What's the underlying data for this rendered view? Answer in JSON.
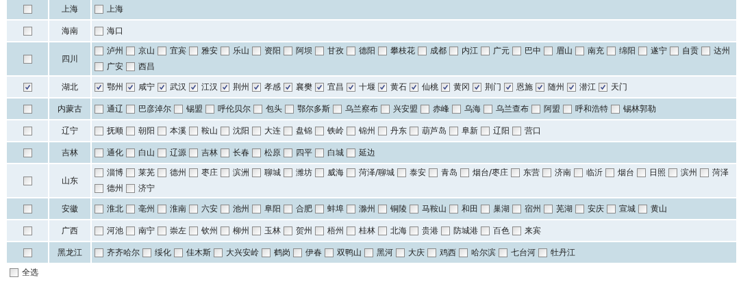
{
  "provinces": [
    {
      "name": "上海",
      "checked": false,
      "cities": [
        {
          "name": "上海",
          "checked": false
        }
      ]
    },
    {
      "name": "海南",
      "checked": false,
      "cities": [
        {
          "name": "海口",
          "checked": false
        }
      ]
    },
    {
      "name": "四川",
      "checked": false,
      "cities": [
        {
          "name": "泸州",
          "checked": false
        },
        {
          "name": "京山",
          "checked": false
        },
        {
          "name": "宜宾",
          "checked": false
        },
        {
          "name": "雅安",
          "checked": false
        },
        {
          "name": "乐山",
          "checked": false
        },
        {
          "name": "资阳",
          "checked": false
        },
        {
          "name": "阿坝",
          "checked": false
        },
        {
          "name": "甘孜",
          "checked": false
        },
        {
          "name": "德阳",
          "checked": false
        },
        {
          "name": "攀枝花",
          "checked": false
        },
        {
          "name": "成都",
          "checked": false
        },
        {
          "name": "内江",
          "checked": false
        },
        {
          "name": "广元",
          "checked": false
        },
        {
          "name": "巴中",
          "checked": false
        },
        {
          "name": "眉山",
          "checked": false
        },
        {
          "name": "南充",
          "checked": false
        },
        {
          "name": "绵阳",
          "checked": false
        },
        {
          "name": "遂宁",
          "checked": false
        },
        {
          "name": "自贡",
          "checked": false
        },
        {
          "name": "达州",
          "checked": false
        },
        {
          "name": "广安",
          "checked": false
        },
        {
          "name": "西昌",
          "checked": false
        }
      ]
    },
    {
      "name": "湖北",
      "checked": true,
      "cities": [
        {
          "name": "鄂州",
          "checked": true
        },
        {
          "name": "咸宁",
          "checked": true
        },
        {
          "name": "武汉",
          "checked": true
        },
        {
          "name": "江汉",
          "checked": true
        },
        {
          "name": "荆州",
          "checked": true
        },
        {
          "name": "孝感",
          "checked": true
        },
        {
          "name": "襄樊",
          "checked": true
        },
        {
          "name": "宜昌",
          "checked": true
        },
        {
          "name": "十堰",
          "checked": true
        },
        {
          "name": "黄石",
          "checked": true
        },
        {
          "name": "仙桃",
          "checked": true
        },
        {
          "name": "黄冈",
          "checked": true
        },
        {
          "name": "荆门",
          "checked": true
        },
        {
          "name": "恩施",
          "checked": true
        },
        {
          "name": "随州",
          "checked": true
        },
        {
          "name": "潜江",
          "checked": true
        },
        {
          "name": "天门",
          "checked": true
        }
      ]
    },
    {
      "name": "内蒙古",
      "checked": false,
      "cities": [
        {
          "name": "通辽",
          "checked": false
        },
        {
          "name": "巴彦淖尔",
          "checked": false
        },
        {
          "name": "锡盟",
          "checked": false
        },
        {
          "name": "呼伦贝尔",
          "checked": false
        },
        {
          "name": "包头",
          "checked": false
        },
        {
          "name": "鄂尔多斯",
          "checked": false
        },
        {
          "name": "乌兰察布",
          "checked": false
        },
        {
          "name": "兴安盟",
          "checked": false
        },
        {
          "name": "赤峰",
          "checked": false
        },
        {
          "name": "乌海",
          "checked": false
        },
        {
          "name": "乌兰查布",
          "checked": false
        },
        {
          "name": "阿盟",
          "checked": false
        },
        {
          "name": "呼和浩特",
          "checked": false
        },
        {
          "name": "锡林郭勒",
          "checked": false
        }
      ]
    },
    {
      "name": "辽宁",
      "checked": false,
      "cities": [
        {
          "name": "抚顺",
          "checked": false
        },
        {
          "name": "朝阳",
          "checked": false
        },
        {
          "name": "本溪",
          "checked": false
        },
        {
          "name": "鞍山",
          "checked": false
        },
        {
          "name": "沈阳",
          "checked": false
        },
        {
          "name": "大连",
          "checked": false
        },
        {
          "name": "盘锦",
          "checked": false
        },
        {
          "name": "铁岭",
          "checked": false
        },
        {
          "name": "锦州",
          "checked": false
        },
        {
          "name": "丹东",
          "checked": false
        },
        {
          "name": "葫芦岛",
          "checked": false
        },
        {
          "name": "阜新",
          "checked": false
        },
        {
          "name": "辽阳",
          "checked": false
        },
        {
          "name": "营口",
          "checked": false
        }
      ]
    },
    {
      "name": "吉林",
      "checked": false,
      "cities": [
        {
          "name": "通化",
          "checked": false
        },
        {
          "name": "白山",
          "checked": false
        },
        {
          "name": "辽源",
          "checked": false
        },
        {
          "name": "吉林",
          "checked": false
        },
        {
          "name": "长春",
          "checked": false
        },
        {
          "name": "松原",
          "checked": false
        },
        {
          "name": "四平",
          "checked": false
        },
        {
          "name": "白城",
          "checked": false
        },
        {
          "name": "延边",
          "checked": false
        }
      ]
    },
    {
      "name": "山东",
      "checked": false,
      "cities": [
        {
          "name": "淄博",
          "checked": false
        },
        {
          "name": "莱芜",
          "checked": false
        },
        {
          "name": "德州",
          "checked": false
        },
        {
          "name": "枣庄",
          "checked": false
        },
        {
          "name": "滨洲",
          "checked": false
        },
        {
          "name": "聊城",
          "checked": false
        },
        {
          "name": "潍坊",
          "checked": false
        },
        {
          "name": "威海",
          "checked": false
        },
        {
          "name": "菏泽/聊城",
          "checked": false
        },
        {
          "name": "泰安",
          "checked": false
        },
        {
          "name": "青岛",
          "checked": false
        },
        {
          "name": "烟台/枣庄",
          "checked": false
        },
        {
          "name": "东营",
          "checked": false
        },
        {
          "name": "济南",
          "checked": false
        },
        {
          "name": "临沂",
          "checked": false
        },
        {
          "name": "烟台",
          "checked": false
        },
        {
          "name": "日照",
          "checked": false
        },
        {
          "name": "滨州",
          "checked": false
        },
        {
          "name": "菏泽",
          "checked": false
        },
        {
          "name": "德州",
          "checked": false
        },
        {
          "name": "济宁",
          "checked": false
        }
      ]
    },
    {
      "name": "安徽",
      "checked": false,
      "cities": [
        {
          "name": "淮北",
          "checked": false
        },
        {
          "name": "亳州",
          "checked": false
        },
        {
          "name": "淮南",
          "checked": false
        },
        {
          "name": "六安",
          "checked": false
        },
        {
          "name": "池州",
          "checked": false
        },
        {
          "name": "阜阳",
          "checked": false
        },
        {
          "name": "合肥",
          "checked": false
        },
        {
          "name": "蚌埠",
          "checked": false
        },
        {
          "name": "滁州",
          "checked": false
        },
        {
          "name": "铜陵",
          "checked": false
        },
        {
          "name": "马鞍山",
          "checked": false
        },
        {
          "name": "和田",
          "checked": false
        },
        {
          "name": "巢湖",
          "checked": false
        },
        {
          "name": "宿州",
          "checked": false
        },
        {
          "name": "芜湖",
          "checked": false
        },
        {
          "name": "安庆",
          "checked": false
        },
        {
          "name": "宣城",
          "checked": false
        },
        {
          "name": "黄山",
          "checked": false
        }
      ]
    },
    {
      "name": "广西",
      "checked": false,
      "cities": [
        {
          "name": "河池",
          "checked": false
        },
        {
          "name": "南宁",
          "checked": false
        },
        {
          "name": "崇左",
          "checked": false
        },
        {
          "name": "钦州",
          "checked": false
        },
        {
          "name": "柳州",
          "checked": false
        },
        {
          "name": "玉林",
          "checked": false
        },
        {
          "name": "贺州",
          "checked": false
        },
        {
          "name": "梧州",
          "checked": false
        },
        {
          "name": "桂林",
          "checked": false
        },
        {
          "name": "北海",
          "checked": false
        },
        {
          "name": "贵港",
          "checked": false
        },
        {
          "name": "防城港",
          "checked": false
        },
        {
          "name": "百色",
          "checked": false
        },
        {
          "name": "来宾",
          "checked": false
        }
      ]
    },
    {
      "name": "黑龙江",
      "checked": false,
      "cities": [
        {
          "name": "齐齐哈尔",
          "checked": false
        },
        {
          "name": "绥化",
          "checked": false
        },
        {
          "name": "佳木斯",
          "checked": false
        },
        {
          "name": "大兴安岭",
          "checked": false
        },
        {
          "name": "鹤岗",
          "checked": false
        },
        {
          "name": "伊春",
          "checked": false
        },
        {
          "name": "双鸭山",
          "checked": false
        },
        {
          "name": "黑河",
          "checked": false
        },
        {
          "name": "大庆",
          "checked": false
        },
        {
          "name": "鸡西",
          "checked": false
        },
        {
          "name": "哈尔滨",
          "checked": false
        },
        {
          "name": "七台河",
          "checked": false
        },
        {
          "name": "牡丹江",
          "checked": false
        }
      ]
    }
  ],
  "select_all": {
    "label": "全选",
    "checked": false
  }
}
